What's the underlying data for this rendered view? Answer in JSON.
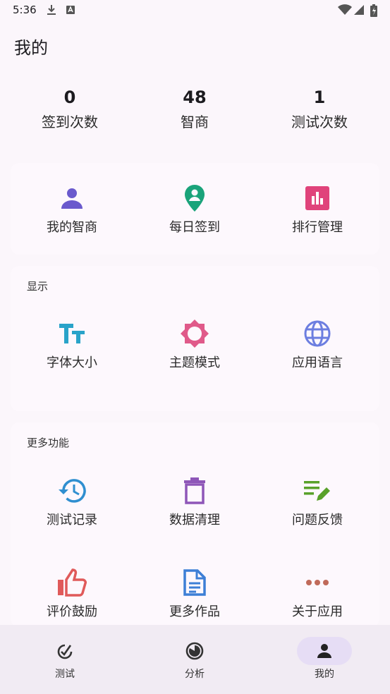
{
  "status_bar": {
    "time": "5:36"
  },
  "page": {
    "title": "我的"
  },
  "stats": [
    {
      "value": "0",
      "label": "签到次数"
    },
    {
      "value": "48",
      "label": "智商"
    },
    {
      "value": "1",
      "label": "测试次数"
    }
  ],
  "top_card": {
    "items": [
      {
        "label": "我的智商",
        "icon": "person-icon",
        "color": "#6a5acd"
      },
      {
        "label": "每日签到",
        "icon": "location-pin-icon",
        "color": "#1aa37a"
      },
      {
        "label": "排行管理",
        "icon": "bar-chart-icon",
        "color": "#e0437b"
      }
    ]
  },
  "display_card": {
    "title": "显示",
    "items": [
      {
        "label": "字体大小",
        "icon": "text-size-icon",
        "color": "#29a3c9"
      },
      {
        "label": "主题模式",
        "icon": "sun-icon",
        "color": "#e05a8a"
      },
      {
        "label": "应用语言",
        "icon": "globe-icon",
        "color": "#6c7ee0"
      }
    ]
  },
  "more_card": {
    "title": "更多功能",
    "items": [
      {
        "label": "测试记录",
        "icon": "history-icon",
        "color": "#2f8fd0"
      },
      {
        "label": "数据清理",
        "icon": "trash-icon",
        "color": "#8e56b8"
      },
      {
        "label": "问题反馈",
        "icon": "feedback-edit-icon",
        "color": "#59a12a"
      },
      {
        "label": "评价鼓励",
        "icon": "thumbs-up-icon",
        "color": "#e05a5a"
      },
      {
        "label": "更多作品",
        "icon": "document-icon",
        "color": "#3d7fd6"
      },
      {
        "label": "关于应用",
        "icon": "more-dots-icon",
        "color": "#c06a5a"
      }
    ]
  },
  "bottom_nav": {
    "items": [
      {
        "label": "测试",
        "icon": "test-icon"
      },
      {
        "label": "分析",
        "icon": "analysis-icon"
      },
      {
        "label": "我的",
        "icon": "profile-icon",
        "active": true
      }
    ]
  }
}
